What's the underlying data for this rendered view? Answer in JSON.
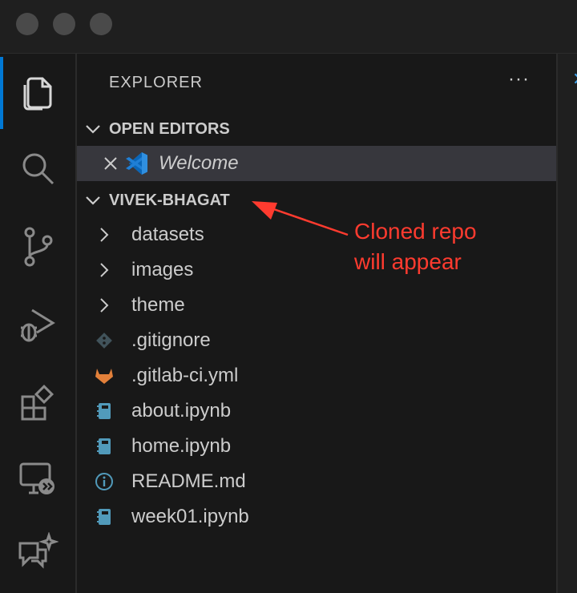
{
  "explorer": {
    "title": "EXPLORER",
    "more_label": "···"
  },
  "open_editors": {
    "header": "OPEN EDITORS",
    "items": [
      {
        "label": "Welcome"
      }
    ]
  },
  "workspace": {
    "header": "VIVEK-BHAGAT",
    "folders": [
      {
        "label": "datasets"
      },
      {
        "label": "images"
      },
      {
        "label": "theme"
      }
    ],
    "files": [
      {
        "label": ".gitignore",
        "icon": "git-icon"
      },
      {
        "label": ".gitlab-ci.yml",
        "icon": "gitlab-icon"
      },
      {
        "label": "about.ipynb",
        "icon": "notebook-icon"
      },
      {
        "label": "home.ipynb",
        "icon": "notebook-icon"
      },
      {
        "label": "README.md",
        "icon": "info-icon"
      },
      {
        "label": "week01.ipynb",
        "icon": "notebook-icon"
      }
    ]
  },
  "annotation": {
    "line1": "Cloned repo",
    "line2": "will appear",
    "color": "#ff3b2f"
  },
  "colors": {
    "accent": "#0078d4",
    "notebook": "#519aba",
    "gitlab": "#e2803a"
  }
}
